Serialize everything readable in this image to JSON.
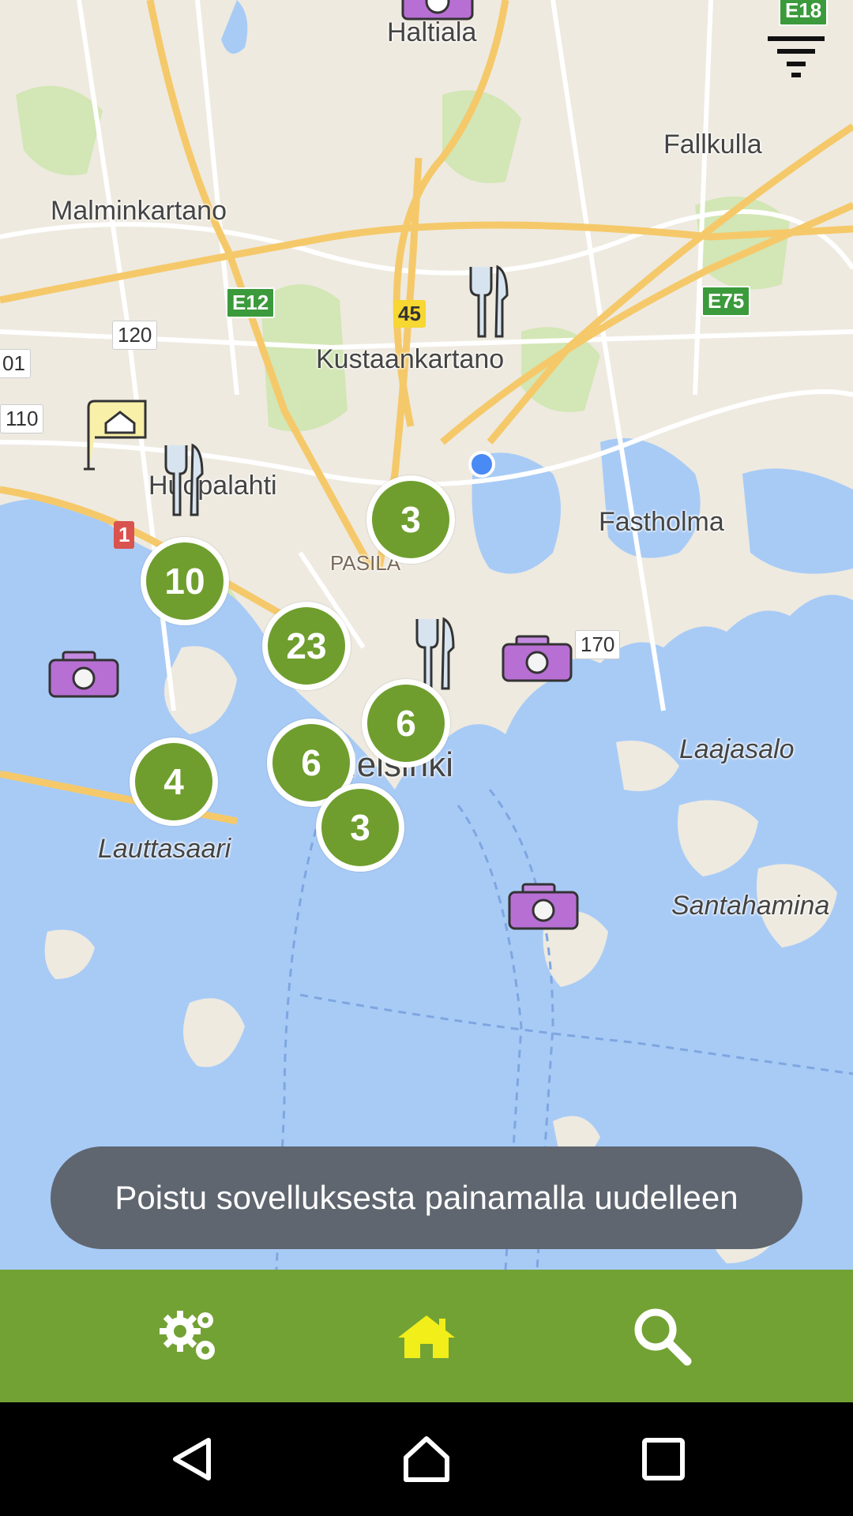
{
  "map": {
    "places": [
      {
        "name": "Haltiala",
        "style": "normal"
      },
      {
        "name": "Fallkulla",
        "style": "normal"
      },
      {
        "name": "Malminkartano",
        "style": "normal"
      },
      {
        "name": "Kustaankartano",
        "style": "normal"
      },
      {
        "name": "Huopalahti",
        "style": "normal"
      },
      {
        "name": "Fastholma",
        "style": "normal"
      },
      {
        "name": "PASILA",
        "style": "small"
      },
      {
        "name": "Helsinki",
        "style": "normal"
      },
      {
        "name": "Laajasalo",
        "style": "italic"
      },
      {
        "name": "Lauttasaari",
        "style": "italic"
      },
      {
        "name": "Santahamina",
        "style": "italic"
      }
    ],
    "road_shields": [
      {
        "label": "E18",
        "type": "green"
      },
      {
        "label": "E12",
        "type": "green"
      },
      {
        "label": "E75",
        "type": "green"
      },
      {
        "label": "45",
        "type": "yellow"
      },
      {
        "label": "120",
        "type": "white"
      },
      {
        "label": "01",
        "type": "white"
      },
      {
        "label": "110",
        "type": "white"
      },
      {
        "label": "1",
        "type": "red"
      },
      {
        "label": "170",
        "type": "white"
      }
    ],
    "clusters": [
      {
        "count": "3"
      },
      {
        "count": "10"
      },
      {
        "count": "23"
      },
      {
        "count": "6"
      },
      {
        "count": "6"
      },
      {
        "count": "4"
      },
      {
        "count": "3"
      }
    ],
    "cluster_color": "#6f9e2e",
    "water_color": "#a8cbf6",
    "land_color": "#eeeae0",
    "park_color": "#cfe5b0",
    "road_color": "#f5c96a",
    "marker_icons": [
      "camera-icon",
      "restaurant-icon",
      "hostel-flag-icon",
      "location-dot-icon"
    ]
  },
  "toast": {
    "message": "Poistu sovelluksesta painamalla uudelleen"
  },
  "bottom_bar": {
    "color": "#72a234",
    "tabs": [
      {
        "icon": "settings-gears-icon",
        "active": false
      },
      {
        "icon": "home-icon",
        "active": true
      },
      {
        "icon": "search-icon",
        "active": false
      }
    ],
    "active_color": "#f2ee1a"
  },
  "filter": {
    "icon": "filter-icon"
  },
  "system_nav": [
    "back-icon",
    "home-circle-icon",
    "recents-square-icon"
  ]
}
